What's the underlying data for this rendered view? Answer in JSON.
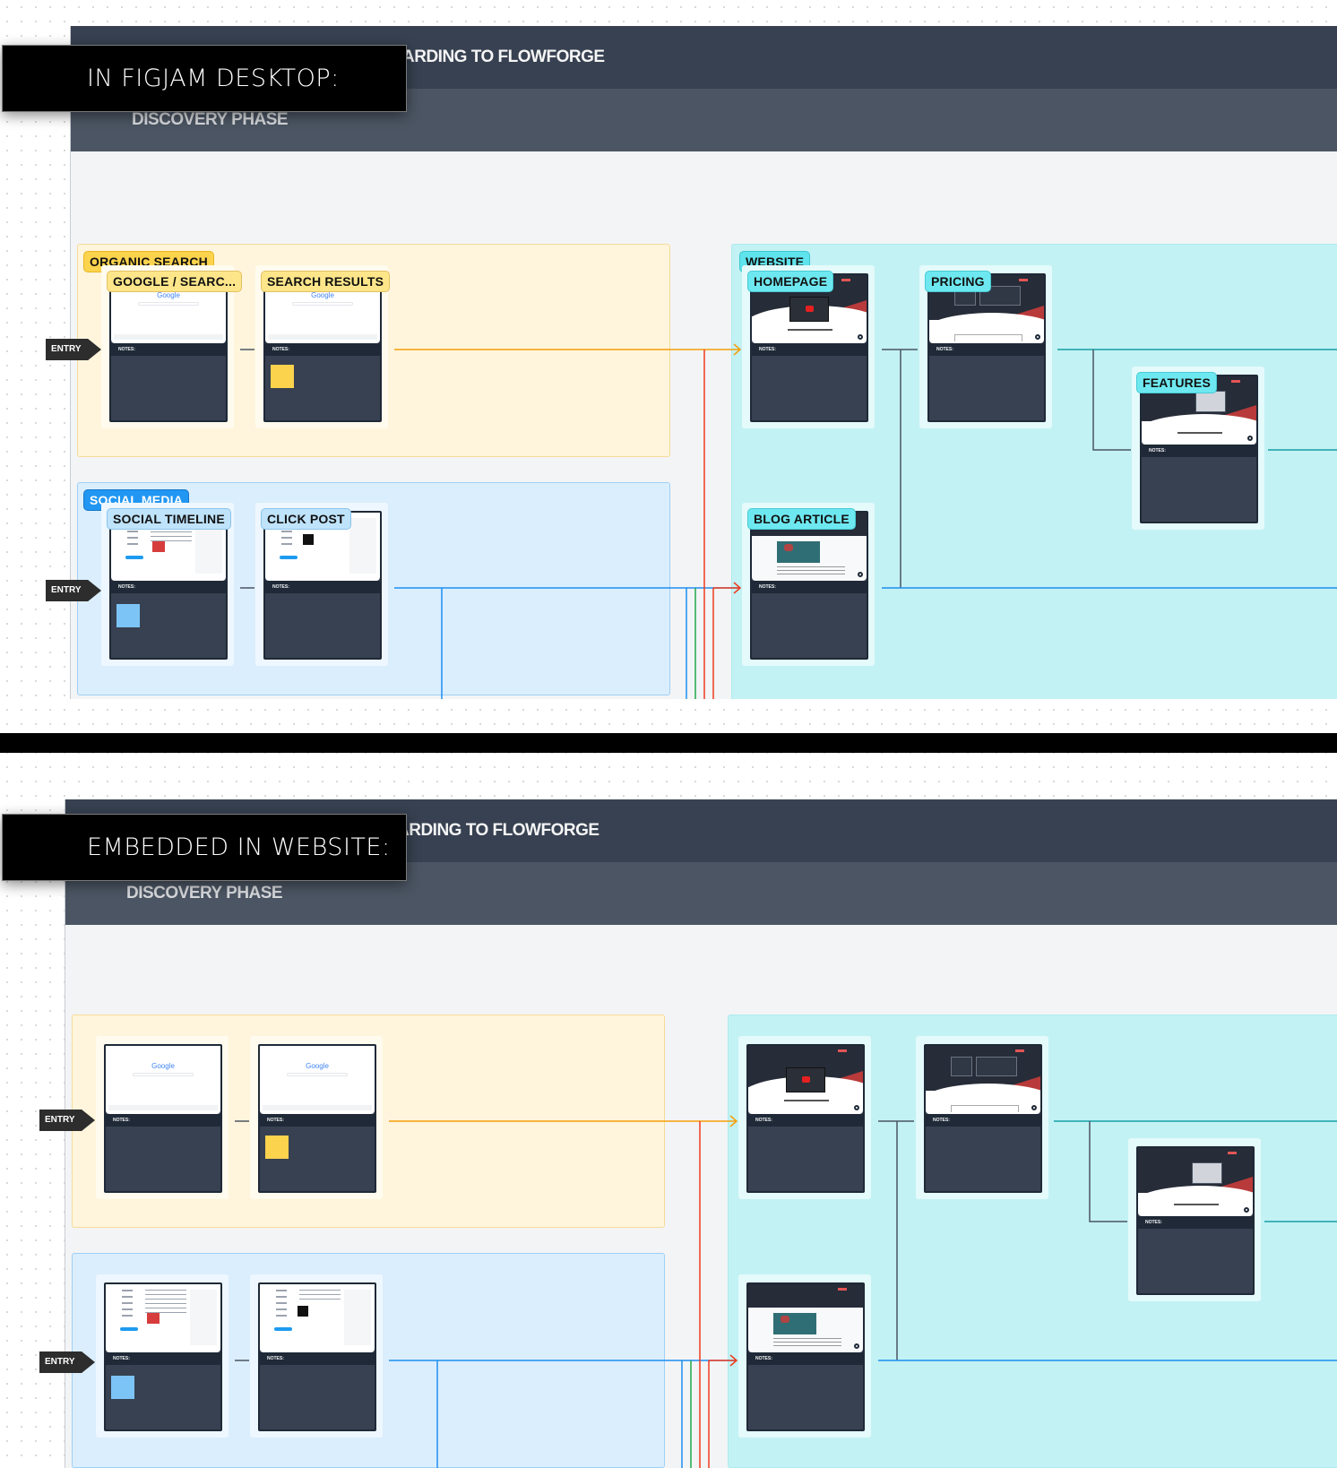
{
  "panels": [
    {
      "label": "IN FIGJAM DESKTOP:",
      "board_title": "ONBOARDING TO FLOWFORGE",
      "board_title_visible": "ARDING TO FLOWFORGE",
      "phase_title": "DISCOVERY PHASE",
      "show_tags": true
    },
    {
      "label": "EMBEDDED IN WEBSITE:",
      "board_title": "ONBOARDING TO FLOWFORGE",
      "board_title_visible": "ARDING TO FLOWFORGE",
      "phase_title": "DISCOVERY PHASE",
      "show_tags": false
    }
  ],
  "sections": {
    "organic": {
      "label": "ORGANIC SEARCH",
      "color": "#fcd34d",
      "cards": [
        {
          "label": "GOOGLE / SEARC...",
          "notes_label": "NOTES:",
          "sticky": null
        },
        {
          "label": "SEARCH RESULTS",
          "notes_label": "NOTES:",
          "sticky": "yellow"
        }
      ]
    },
    "social": {
      "label": "SOCIAL MEDIA",
      "color": "#2196f3",
      "cards": [
        {
          "label": "SOCIAL TIMELINE",
          "notes_label": "NOTES:",
          "sticky": "blue"
        },
        {
          "label": "CLICK POST",
          "notes_label": "NOTES:",
          "sticky": null
        }
      ]
    },
    "website": {
      "label": "WEBSITE",
      "color": "#5fe3ec",
      "cards": [
        {
          "label": "HOMEPAGE",
          "notes_label": "NOTES:"
        },
        {
          "label": "PRICING",
          "notes_label": "NOTES:"
        },
        {
          "label": "FEATURES",
          "notes_label": "NOTES:"
        },
        {
          "label": "BLOG ARTICLE",
          "notes_label": "NOTES:"
        }
      ]
    }
  },
  "entry_label": "ENTRY",
  "thumbnail_text": {
    "google_logo": "Google"
  },
  "connector_colors": {
    "organic": "#f59e0b",
    "social": "#1d8ff0",
    "red": "#ef3b1e",
    "green": "#22a84a",
    "website": "#14a0a6",
    "neutral": "#4b5563"
  }
}
